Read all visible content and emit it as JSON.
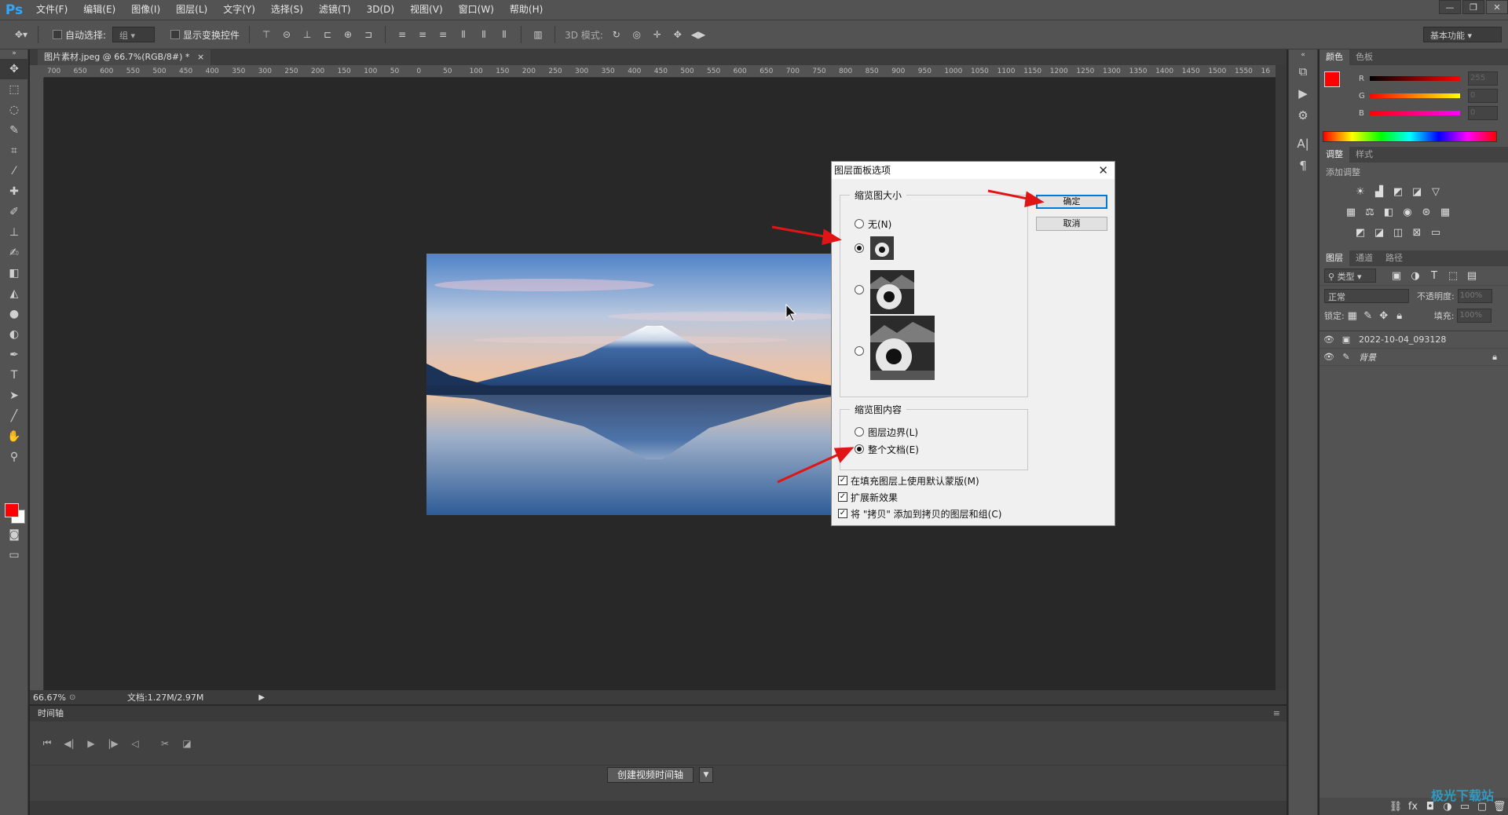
{
  "app": {
    "logo": "Ps"
  },
  "menu": [
    "文件(F)",
    "编辑(E)",
    "图像(I)",
    "图层(L)",
    "文字(Y)",
    "选择(S)",
    "滤镜(T)",
    "3D(D)",
    "视图(V)",
    "窗口(W)",
    "帮助(H)"
  ],
  "window_controls": [
    "—",
    "❐",
    "✕"
  ],
  "options": {
    "auto_select_label": "自动选择:",
    "auto_select_value": "组",
    "show_transform_label": "显示变换控件",
    "mode_3d_label": "3D 模式:",
    "workspace": "基本功能"
  },
  "document": {
    "tab_title": "图片素材.jpeg @ 66.7%(RGB/8#) *",
    "zoom": "66.67%",
    "doc_info": "文档:1.27M/2.97M"
  },
  "ruler_ticks": [
    "700",
    "650",
    "600",
    "550",
    "500",
    "450",
    "400",
    "350",
    "300",
    "250",
    "200",
    "150",
    "100",
    "50",
    "0",
    "50",
    "100",
    "150",
    "200",
    "250",
    "300",
    "350",
    "400",
    "450",
    "500",
    "550",
    "600",
    "650",
    "700",
    "750",
    "800",
    "850",
    "900",
    "950",
    "1000",
    "1050",
    "1100",
    "1150",
    "1200",
    "1250",
    "1300",
    "1350",
    "1400",
    "1450",
    "1500",
    "1550",
    "16"
  ],
  "timeline": {
    "title": "时间轴",
    "create_button": "创建视频时间轴"
  },
  "panels": {
    "color_tabs": [
      "颜色",
      "色板"
    ],
    "color": {
      "r": "255",
      "g": "0",
      "b": "0",
      "labels": [
        "R",
        "G",
        "B"
      ]
    },
    "adjust_tabs": [
      "调整",
      "样式"
    ],
    "adjust_title": "添加调整",
    "layers_tabs": [
      "图层",
      "通道",
      "路径"
    ],
    "layer_filter": "类型",
    "blend_mode": "正常",
    "opacity_label": "不透明度:",
    "opacity_value": "100%",
    "lock_label": "锁定:",
    "fill_label": "填充:",
    "fill_value": "100%",
    "layers": [
      {
        "name": "2022-10-04_093128"
      },
      {
        "name": "背景"
      }
    ]
  },
  "dialog": {
    "title": "图层面板选项",
    "close": "✕",
    "thumb_size_title": "缩览图大小",
    "none_label": "无(N)",
    "thumb_content_title": "缩览图内容",
    "layer_bounds_label": "图层边界(L)",
    "whole_doc_label": "整个文档(E)",
    "ok": "确定",
    "cancel": "取消",
    "check1": "在填充图层上使用默认蒙版(M)",
    "check2": "扩展新效果",
    "check3": "将 \"拷贝\" 添加到拷贝的图层和组(C)"
  },
  "watermark": "极光下载站"
}
